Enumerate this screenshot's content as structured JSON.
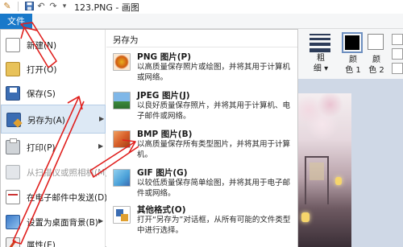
{
  "window": {
    "title": "123.PNG - 画图",
    "quick_access_icons": [
      "paint-app-icon",
      "save-icon",
      "undo-icon",
      "redo-icon",
      "customize-icon"
    ]
  },
  "file_tab": {
    "label": "文件"
  },
  "ribbon": {
    "stroke_label": "粗\n细",
    "color1_label": "颜\n色 1",
    "color2_label": "颜\n色 2",
    "stroke_label_text": "粗",
    "stroke_label_text2": "细 ▾",
    "color1_top": "颜",
    "color1_bottom": "色 1",
    "color2_top": "颜",
    "color2_bottom": "色 2",
    "color1_value": "#000000",
    "color2_value": "#ffffff"
  },
  "file_menu": {
    "items": [
      {
        "label": "新建(N)",
        "icon": "new-file-icon",
        "disabled": false,
        "has_submenu": false
      },
      {
        "label": "打开(O)",
        "icon": "open-folder-icon",
        "disabled": false,
        "has_submenu": false
      },
      {
        "label": "保存(S)",
        "icon": "save-icon",
        "disabled": false,
        "has_submenu": false
      },
      {
        "label": "另存为(A)",
        "icon": "save-as-icon",
        "disabled": false,
        "has_submenu": true,
        "highlighted": true
      },
      {
        "label": "打印(P)",
        "icon": "printer-icon",
        "disabled": false,
        "has_submenu": true
      },
      {
        "label": "从扫描仪或照相机(M)",
        "icon": "scanner-icon",
        "disabled": true,
        "has_submenu": false
      },
      {
        "label": "在电子邮件中发送(D)",
        "icon": "email-icon",
        "disabled": false,
        "has_submenu": false
      },
      {
        "label": "设置为桌面背景(B)",
        "icon": "desktop-background-icon",
        "disabled": false,
        "has_submenu": true
      },
      {
        "label": "属性(E)",
        "icon": "properties-icon",
        "disabled": false,
        "has_submenu": false
      }
    ]
  },
  "save_as_submenu": {
    "header": "另存为",
    "items": [
      {
        "title": "PNG 图片(P)",
        "desc": "以高质量保存照片或绘图，并将其用于计算机或网络。",
        "icon": "png-image-icon"
      },
      {
        "title": "JPEG 图片(J)",
        "desc": "以良好质量保存照片，并将其用于计算机、电子邮件或网络。",
        "icon": "jpeg-image-icon"
      },
      {
        "title": "BMP 图片(B)",
        "desc": "以高质量保存所有类型图片，并将其用于计算机。",
        "icon": "bmp-image-icon"
      },
      {
        "title": "GIF 图片(G)",
        "desc": "以较低质量保存简单绘图，并将其用于电子邮件或网络。",
        "icon": "gif-image-icon"
      },
      {
        "title": "其他格式(O)",
        "desc": "打开“另存为”对话框，从所有可能的文件类型中进行选择。",
        "icon": "other-formats-icon"
      }
    ]
  },
  "colors": {
    "accent": "#1979ca",
    "highlight": "#dde9f5",
    "annotation": "#e0201e"
  }
}
